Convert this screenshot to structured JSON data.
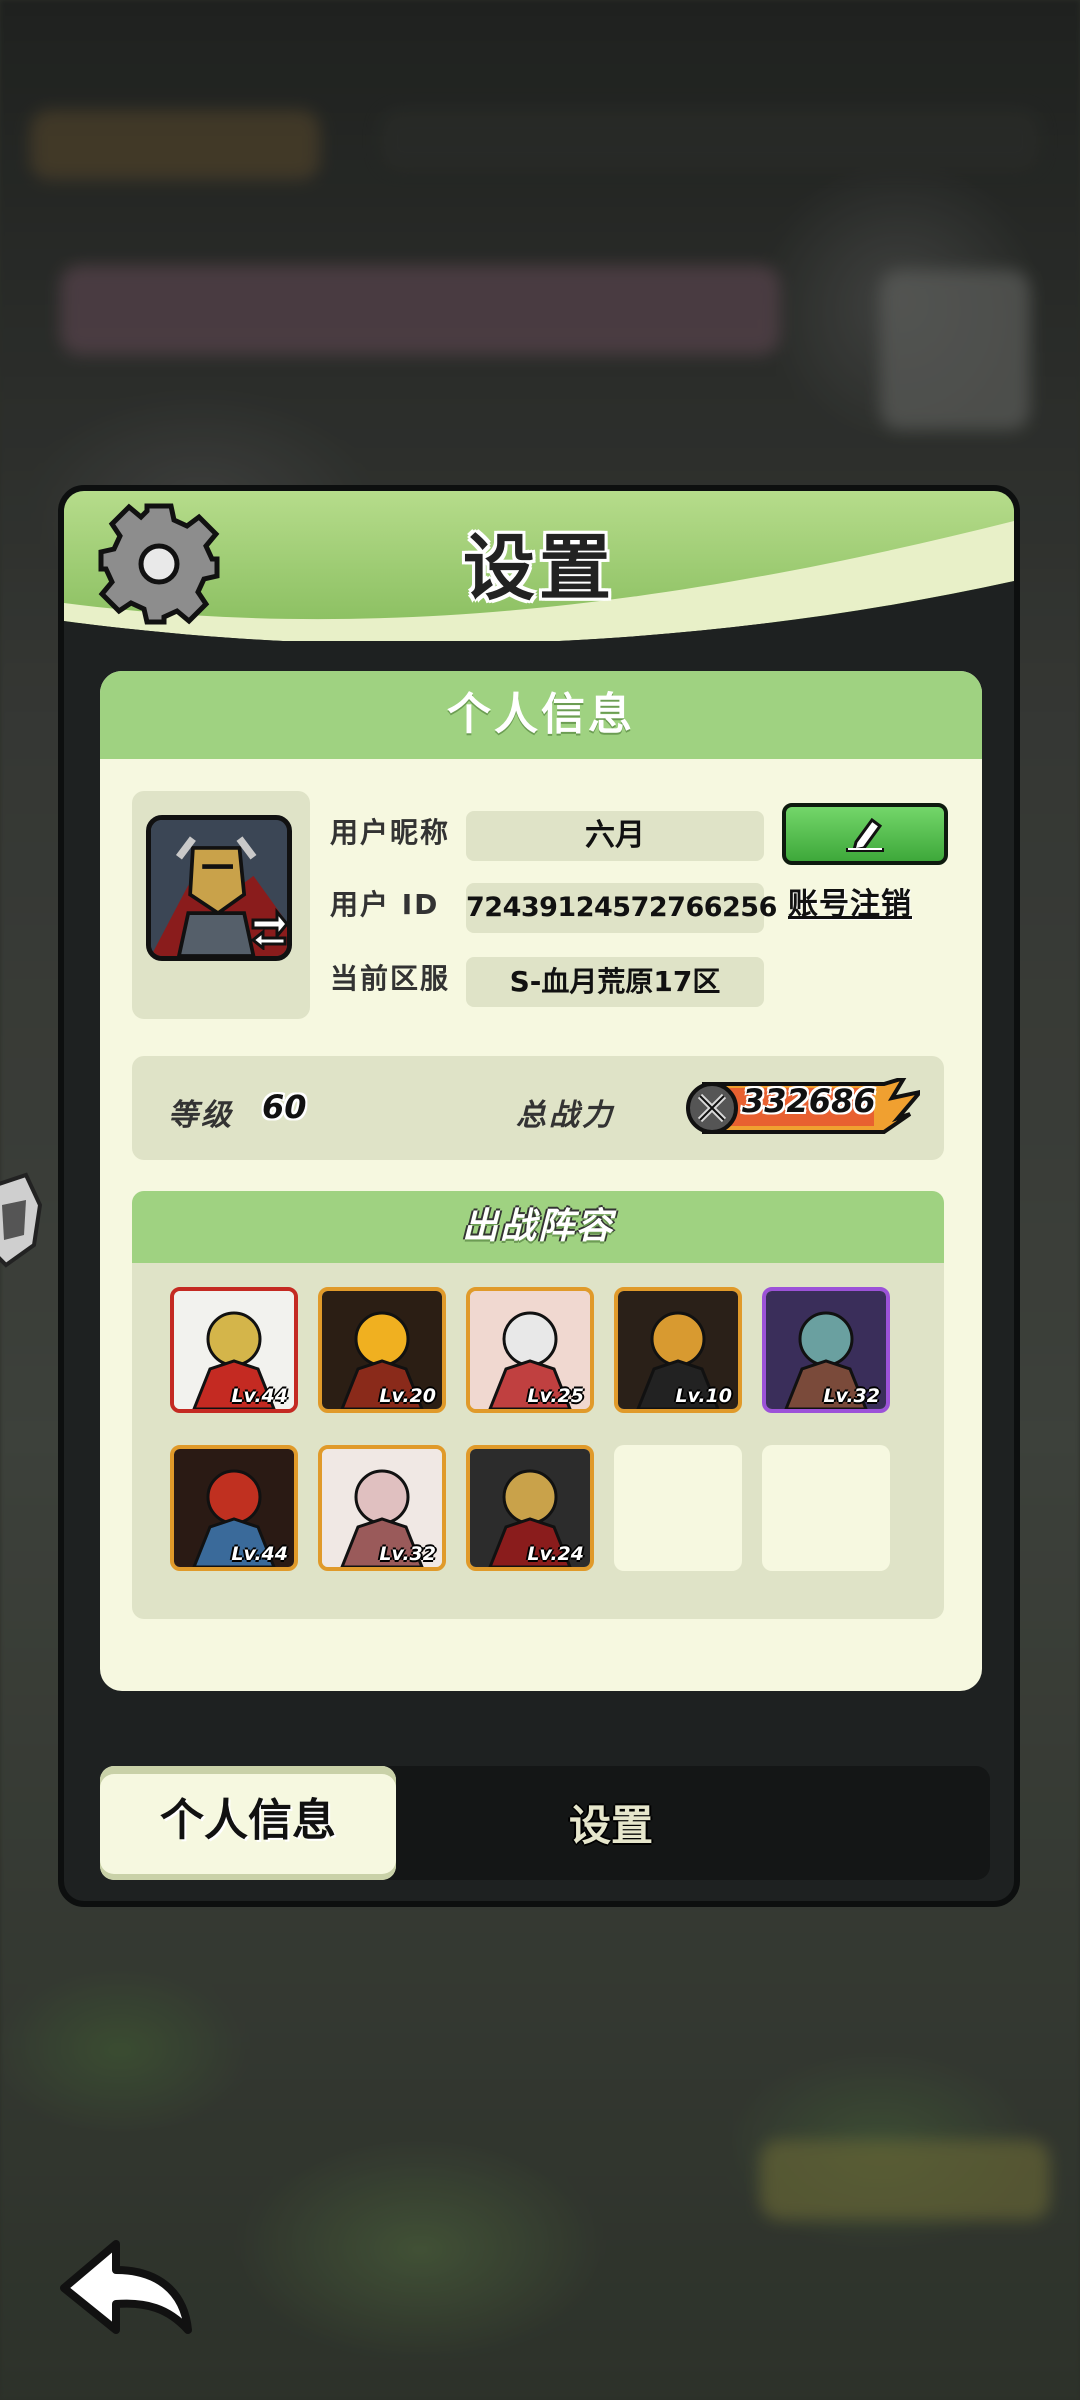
{
  "panel": {
    "title": "设置"
  },
  "personal": {
    "header": "个人信息",
    "labels": {
      "nickname": "用户昵称",
      "user_id": "用户 ID",
      "server": "当前区服"
    },
    "nickname": "六月",
    "user_id": "72439124572766256",
    "server": "S-血月荒原17区",
    "logout": "账号注销"
  },
  "stats": {
    "level_label": "等级",
    "level": "60",
    "power_label": "总战力",
    "power": "332686"
  },
  "lineup": {
    "title": "出战阵容",
    "heroes": [
      {
        "level": "Lv.44",
        "frame": "red"
      },
      {
        "level": "Lv.20",
        "frame": "gold"
      },
      {
        "level": "Lv.25",
        "frame": "gold"
      },
      {
        "level": "Lv.10",
        "frame": "gold"
      },
      {
        "level": "Lv.32",
        "frame": "purple"
      },
      {
        "level": "Lv.44",
        "frame": "gold"
      },
      {
        "level": "Lv.32",
        "frame": "gold"
      },
      {
        "level": "Lv.24",
        "frame": "gold"
      },
      {
        "level": "",
        "frame": "empty"
      },
      {
        "level": "",
        "frame": "empty"
      }
    ]
  },
  "tabs": {
    "active": "个人信息",
    "inactive": "设置"
  },
  "colors": {
    "accent_green": "#9fd281",
    "card_bg": "#f6f8e0",
    "panel_bg": "#1e2121",
    "edit_button": "#3ea83a"
  }
}
